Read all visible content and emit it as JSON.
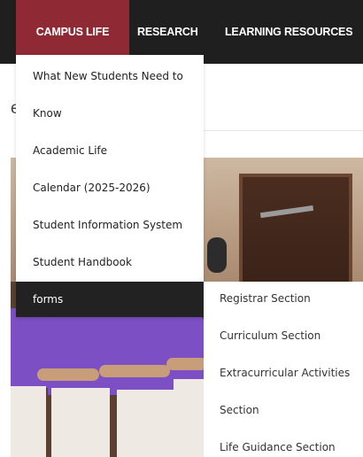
{
  "nav": {
    "tabs": [
      {
        "label": "CAMPUS LIFE"
      },
      {
        "label": "RESEARCH"
      },
      {
        "label": "LEARNING RESOURCES"
      }
    ],
    "active_color": "#8f2a35"
  },
  "background": {
    "fragment_a": "e",
    "fragment_b": "e"
  },
  "dropdown": {
    "items": [
      "What New Students Need to",
      "Know",
      "Academic Life",
      "Calendar (2025-2026)",
      "Student Information System",
      "Student Handbook",
      "forms"
    ]
  },
  "submenu": {
    "items": [
      "Registrar Section",
      "Curriculum Section",
      "Extracurricular Activities",
      "Section",
      "Life Guidance Section"
    ]
  }
}
